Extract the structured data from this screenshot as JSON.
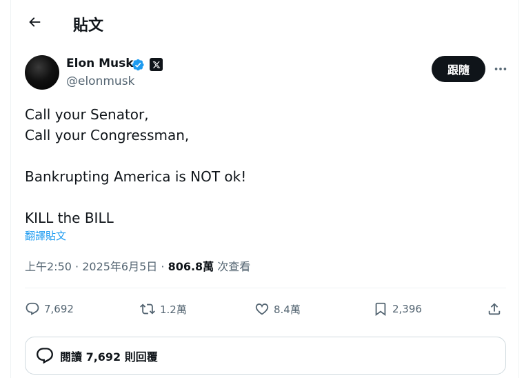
{
  "header": {
    "title": "貼文"
  },
  "author": {
    "name": "Elon Musk",
    "handle": "@elonmusk"
  },
  "follow_label": "跟隨",
  "tweet": {
    "line1": "Call your Senator,",
    "line2": "Call your Congressman,",
    "line3": "Bankrupting America is NOT ok!",
    "line4": "KILL the BILL"
  },
  "translate_label": "翻譯貼文",
  "meta": {
    "time": "上午2:50",
    "date": "2025年6月5日",
    "views": "806.8萬",
    "views_label": "次查看"
  },
  "actions": {
    "replies": "7,692",
    "reposts": "1.2萬",
    "likes": "8.4萬",
    "bookmarks": "2,396"
  },
  "reply_bar_label": "閱讀 7,692 則回覆",
  "colors": {
    "accent": "#1d9bf0",
    "text": "#0f1419",
    "secondary": "#536471",
    "verified": "#1d9bf0"
  }
}
